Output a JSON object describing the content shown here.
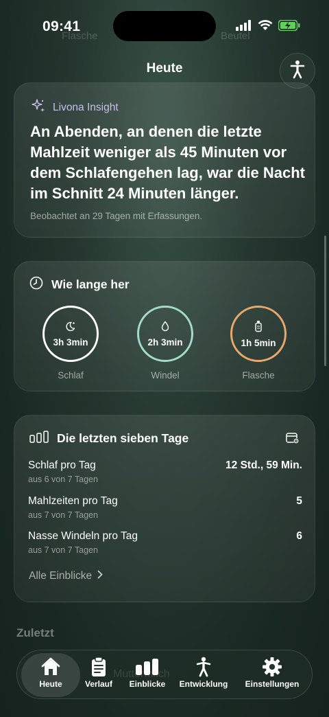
{
  "status_bar": {
    "time": "09:41"
  },
  "background_tabs": {
    "left": "Flasche",
    "right": "Beutel"
  },
  "nav": {
    "title": "Heute",
    "a11y_icon": "accessibility-icon"
  },
  "insight": {
    "label": "Livona Insight",
    "text": "An Abenden, an denen die letzte Mahlzeit weniger als 45 Minuten vor dem Schlafengehen lag, war die Nacht im Schnitt 24 Minuten länger.",
    "footnote": "Beobachtet an 29 Tagen mit Erfassungen.",
    "accent": "#c8bfe6"
  },
  "since": {
    "title": "Wie lange her",
    "items": [
      {
        "label": "Schlaf",
        "value": "3h 3min",
        "icon": "moon-icon",
        "color": "#ffffff"
      },
      {
        "label": "Windel",
        "value": "2h 3min",
        "icon": "drop-icon",
        "color": "#a3dbcb"
      },
      {
        "label": "Flasche",
        "value": "1h 5min",
        "icon": "bottle-icon",
        "color": "#e8a86a"
      }
    ]
  },
  "week": {
    "title": "Die letzten sieben Tage",
    "rows": [
      {
        "name": "Schlaf pro Tag",
        "sub": "aus 6 von 7 Tagen",
        "value": "12 Std., 59 Min."
      },
      {
        "name": "Mahlzeiten pro Tag",
        "sub": "aus 7 von 7 Tagen",
        "value": "5"
      },
      {
        "name": "Nasse Windeln pro Tag",
        "sub": "aus 7 von 7 Tagen",
        "value": "6"
      }
    ],
    "link": "Alle Einblicke"
  },
  "recent": {
    "title": "Zuletzt",
    "ghost_text": "Muttermilch"
  },
  "tabs": [
    {
      "label": "Heute",
      "icon": "house-icon",
      "active": true
    },
    {
      "label": "Verlauf",
      "icon": "clipboard-icon",
      "active": false
    },
    {
      "label": "Einblicke",
      "icon": "bar-chart-icon",
      "active": false
    },
    {
      "label": "Entwicklung",
      "icon": "figure-icon",
      "active": false
    },
    {
      "label": "Einstellungen",
      "icon": "gear-icon",
      "active": false
    }
  ]
}
